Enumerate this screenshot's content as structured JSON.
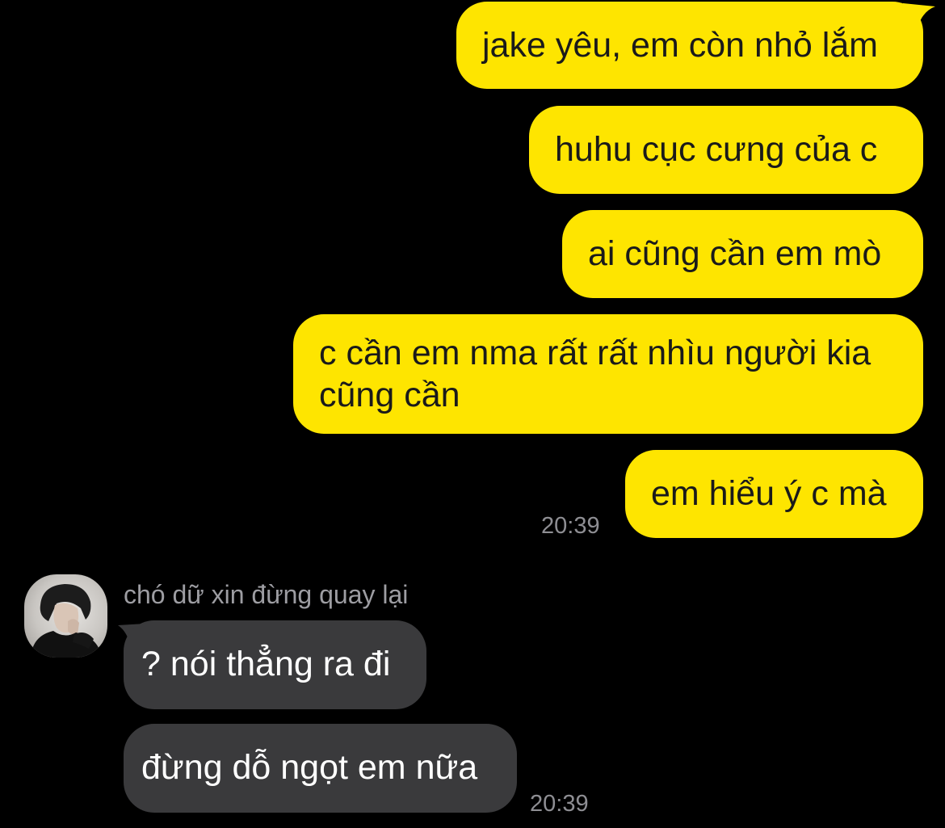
{
  "outgoing": [
    {
      "text": "jake yêu, em còn nhỏ lắm"
    },
    {
      "text": "huhu cục cưng của c"
    },
    {
      "text": "ai cũng cần em mò"
    },
    {
      "text": "c cần em nma rất rất nhìu người kia cũng cần"
    },
    {
      "text": "em hiểu ý c mà"
    }
  ],
  "outgoing_time": "20:39",
  "incoming": {
    "sender_name": "chó dữ xin đừng quay lại",
    "messages": [
      {
        "text": "? nói thẳng ra đi"
      },
      {
        "text": "đừng dỗ ngọt em nữa"
      }
    ],
    "time": "20:39"
  },
  "colors": {
    "background": "#000000",
    "outgoing_bubble": "#FEE500",
    "incoming_bubble": "#3a3a3c",
    "timestamp": "#8e8e93"
  }
}
